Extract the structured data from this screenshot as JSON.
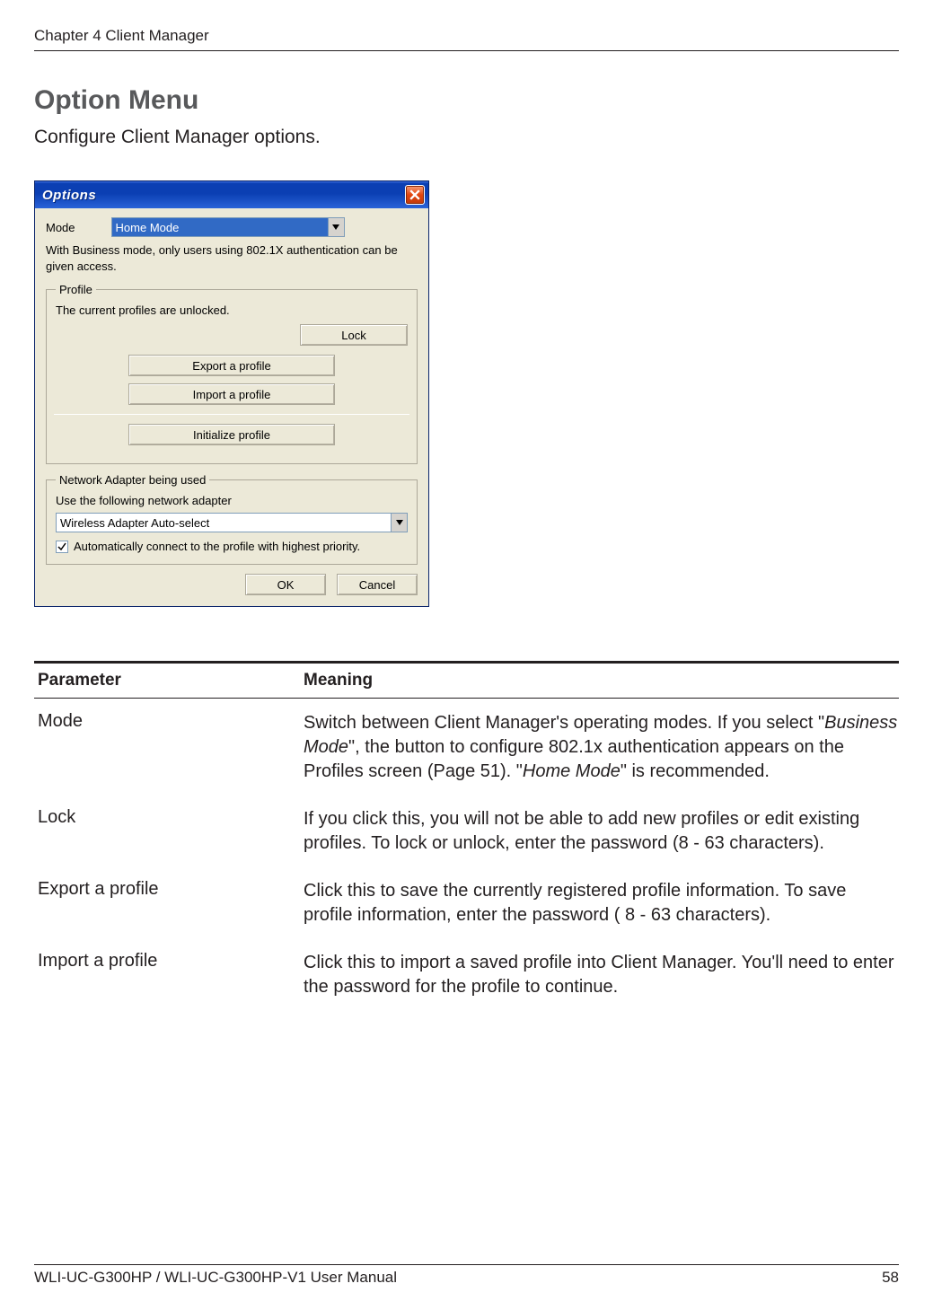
{
  "header": {
    "chapter": "Chapter 4  Client Manager"
  },
  "title": "Option Menu",
  "subtitle": "Configure Client Manager options.",
  "dialog": {
    "title": "Options",
    "mode_label": "Mode",
    "mode_value": "Home Mode",
    "note": "With Business mode, only users using 802.1X authentication can be given access.",
    "profile": {
      "legend": "Profile",
      "unlocked_text": "The current profiles are unlocked.",
      "lock_btn": "Lock",
      "export_btn": "Export a profile",
      "import_btn": "Import a profile",
      "init_btn": "Initialize profile"
    },
    "adapter": {
      "legend": "Network Adapter being used",
      "use_label": "Use the following network adapter",
      "value": "Wireless Adapter Auto-select",
      "auto_check_label": "Automatically connect to the profile with highest priority.",
      "auto_checked": true
    },
    "ok": "OK",
    "cancel": "Cancel"
  },
  "table": {
    "h_param": "Parameter",
    "h_mean": "Meaning",
    "rows": [
      {
        "param": "Mode",
        "meaning_pre": "Switch between Client Manager's operating modes. If you select \"",
        "meaning_it1": "Business Mode",
        "meaning_mid": "\", the button to configure 802.1x authentication appears on the Profiles screen (Page 51). \"",
        "meaning_it2": "Home Mode",
        "meaning_post": "\" is recommended."
      },
      {
        "param": "Lock",
        "meaning": "If you click this, you will not be able to add new profiles or edit existing profiles.  To lock or unlock, enter the password (8 - 63 characters)."
      },
      {
        "param": "Export a profile",
        "meaning": "Click this to save the currently registered profile information. To save profile information, enter the password ( 8 - 63 characters)."
      },
      {
        "param": "Import a profile",
        "meaning": "Click this to import a saved profile into Client Manager.  You'll need to enter the password for the profile to continue."
      }
    ]
  },
  "footer": {
    "left": "WLI-UC-G300HP / WLI-UC-G300HP-V1 User Manual",
    "right": "58"
  }
}
